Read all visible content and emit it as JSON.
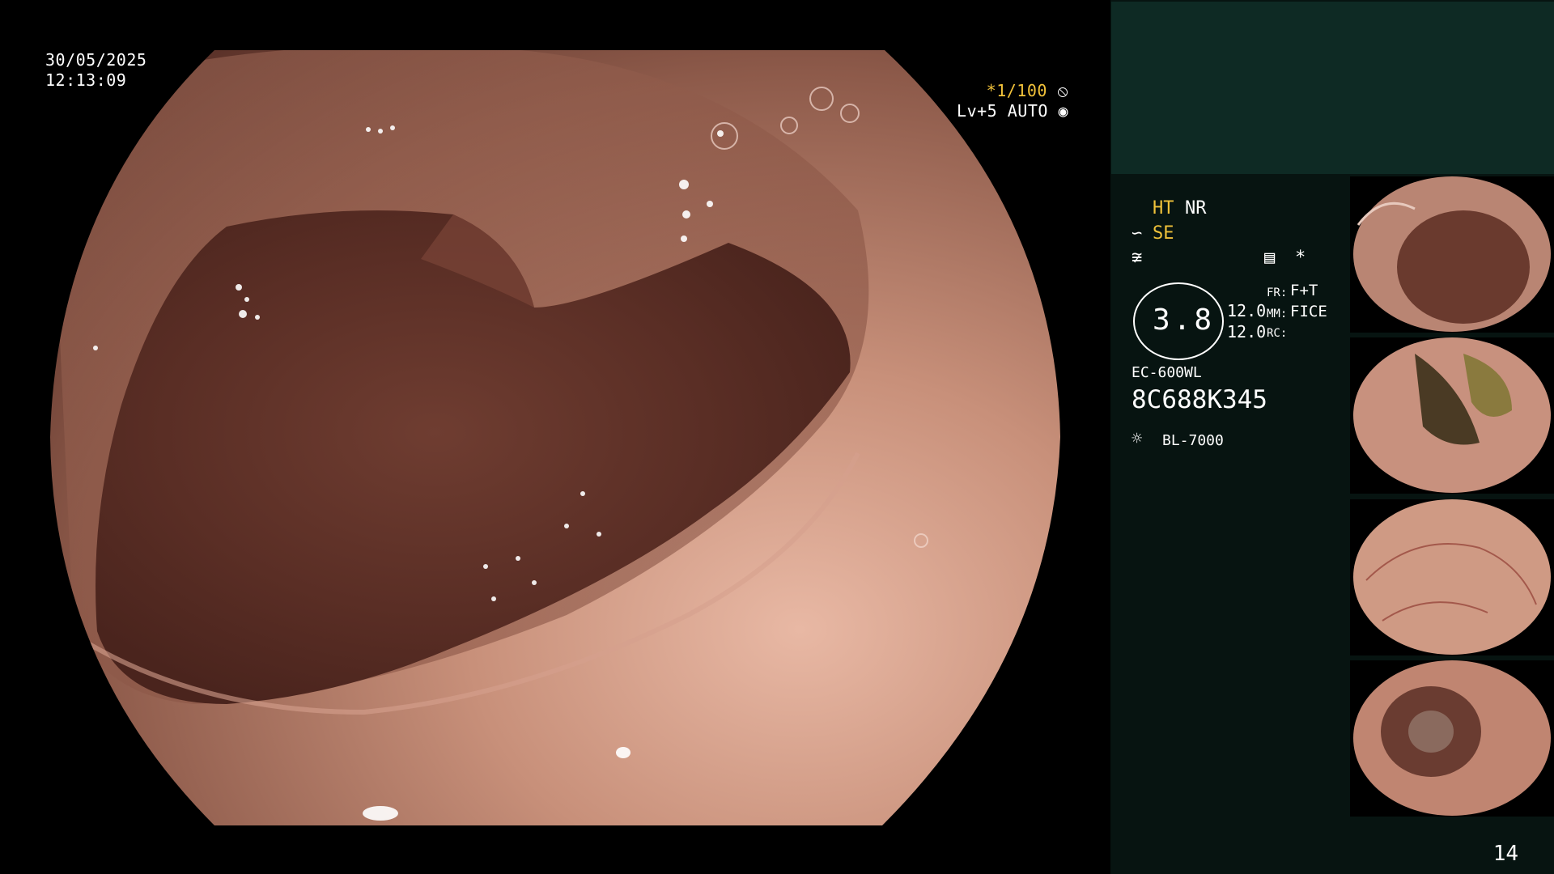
{
  "overlay": {
    "date": "30/05/2025",
    "time": "12:13:09",
    "shutter": "*1/100",
    "level": "Lv+5 AUTO"
  },
  "panel": {
    "ht": "HT",
    "nr": "NR",
    "se": "SE",
    "zoom_value": "3.8",
    "val_a": "12.0",
    "val_b": "12.0",
    "fr_label": "FR:",
    "fr_value": "F+T",
    "mm_label": "MM:",
    "mm_value": "FICE",
    "rc_label": "RC:",
    "scope_model": "EC-600WL",
    "serial": "8C688K345",
    "light_source": "BL-7000",
    "asterisk": "*",
    "page_number": "14"
  },
  "icons": {
    "shutter": "aperture-icon",
    "level": "auto-icon",
    "enhance_1": "curve-icon",
    "enhance_2": "curve-icon",
    "record": "document-icon",
    "lamp": "lamp-icon"
  },
  "colors": {
    "accent": "#f0c23a",
    "panel_bg": "#071411",
    "panel_top": "#0e2a24"
  }
}
